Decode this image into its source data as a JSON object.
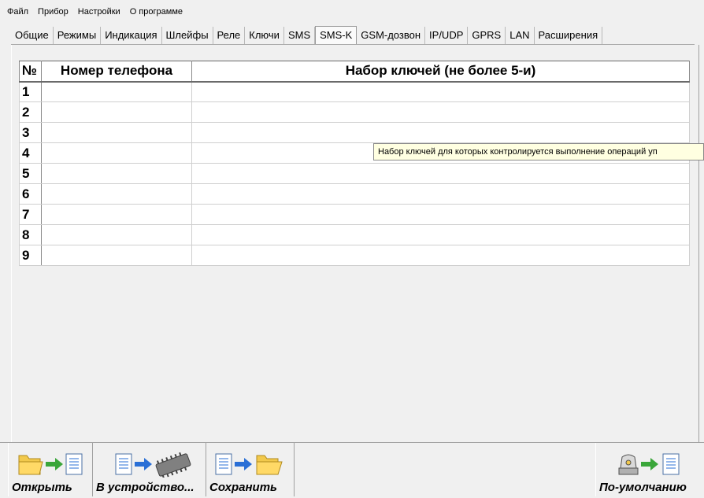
{
  "menu": [
    "Файл",
    "Прибор",
    "Настройки",
    "О программе"
  ],
  "tabs": [
    "Общие",
    "Режимы",
    "Индикация",
    "Шлейфы",
    "Реле",
    "Ключи",
    "SMS",
    "SMS-K",
    "GSM-дозвон",
    "IP/UDP",
    "GPRS",
    "LAN",
    "Расширения"
  ],
  "active_tab": "SMS-K",
  "table": {
    "headers": [
      "№",
      "Номер телефона",
      "Набор ключей (не более 5-и)"
    ],
    "rows": [
      {
        "n": "1",
        "phone": "",
        "keys": ""
      },
      {
        "n": "2",
        "phone": "",
        "keys": ""
      },
      {
        "n": "3",
        "phone": "",
        "keys": ""
      },
      {
        "n": "4",
        "phone": "",
        "keys": ""
      },
      {
        "n": "5",
        "phone": "",
        "keys": ""
      },
      {
        "n": "6",
        "phone": "",
        "keys": ""
      },
      {
        "n": "7",
        "phone": "",
        "keys": ""
      },
      {
        "n": "8",
        "phone": "",
        "keys": ""
      },
      {
        "n": "9",
        "phone": "",
        "keys": ""
      }
    ]
  },
  "tooltip": "Набор ключей для которых контролируется выполнение операций уп",
  "toolbar": {
    "open": "Открыть",
    "to_device": "В устройство...",
    "save": "Сохранить",
    "defaults": "По-умолчанию"
  },
  "colors": {
    "arrow_green": "#3aa63a",
    "arrow_blue": "#2a6fd6",
    "folder": "#f2c94c",
    "tooltip_bg": "#ffffe1"
  }
}
